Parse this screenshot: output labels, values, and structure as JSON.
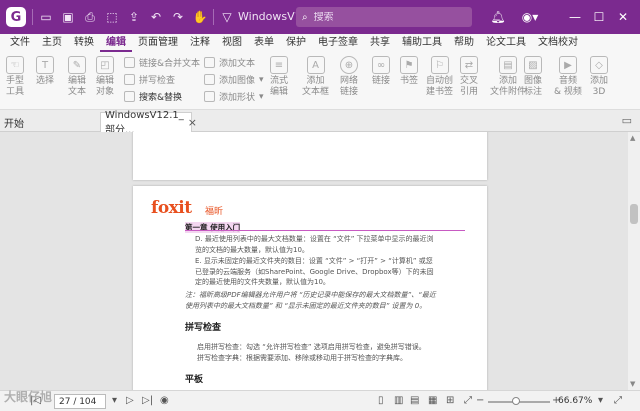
{
  "titlebar": {
    "logo": "G",
    "doc_title": "WindowsV12...",
    "search_placeholder": "搜索",
    "accent": "#7b2a8f"
  },
  "menu": [
    {
      "label": "文件"
    },
    {
      "label": "主页"
    },
    {
      "label": "转换"
    },
    {
      "label": "编辑",
      "active": true
    },
    {
      "label": "页面管理"
    },
    {
      "label": "注释"
    },
    {
      "label": "视图"
    },
    {
      "label": "表单"
    },
    {
      "label": "保护"
    },
    {
      "label": "电子签章"
    },
    {
      "label": "共享"
    },
    {
      "label": "辅助工具"
    },
    {
      "label": "帮助"
    },
    {
      "label": "论文工具"
    },
    {
      "label": "文档校对"
    }
  ],
  "ribbon": {
    "hand_tool": "手型\n工具",
    "select": "选择",
    "edit_text": "编辑\n文本",
    "edit_object": "编辑\n对象",
    "link_merge": "链接&合并文本",
    "spell_check": "拼写检查",
    "search_replace": "搜索&替换",
    "add_text": "添加文本",
    "add_image": "添加图像",
    "add_shape": "添加形状",
    "flow_edit": "流式\n编辑",
    "add_textbox": "添加\n文本框",
    "web_link": "网络\n链接",
    "link": "链接",
    "bookmark": "书签",
    "auto_bookmark": "自动创\n建书签",
    "cross_ref": "交叉\n引用",
    "add_attachment": "添加\n文件附件",
    "image_label": "图像\n标注",
    "audio_video": "音频\n& 视频",
    "add_3d": "添加\n3D"
  },
  "tabs": {
    "start": "开始",
    "doc": "WindowsV12.1_部分...",
    "close": "×"
  },
  "document": {
    "brand": "foxit",
    "brand_cn": "福昕",
    "chapter": "第一章 使用入门",
    "d_item": "D.  最近使用列表中的最大文档数量：设置在 “文件” 下拉菜单中显示的最近浏览的文档的最大数量，默认值为10。",
    "e_item": "E.  显示未固定的最近文件夹的数目：设置 “文件” > “打开” > “计算机” 或您已登录的云端服务（如SharePoint、Google Drive、Dropbox等）下的未固定的最近使用的文件夹数量，默认值为10。",
    "note": "注：福昕高级PDF编辑器允许用户将 “历史记录中能保存的最大文档数量”、“最近使用列表中的最大文档数量” 和 “显示未固定的最近文件夹的数目” 设置为 0。",
    "spell_heading": "拼写检查",
    "spell_p1": "启用拼写检查：勾选 “允许拼写检查” 选项启用拼写检查，避免拼写错误。",
    "spell_p2": "拼写检查字典：根据需要添加、移除或移动用于拼写检查的字典库。",
    "tablet_heading": "平板"
  },
  "statusbar": {
    "page": "27 / 104",
    "zoom": "66.67%",
    "zoom_fraction": 0.45
  },
  "watermark": "大眼仔旭"
}
